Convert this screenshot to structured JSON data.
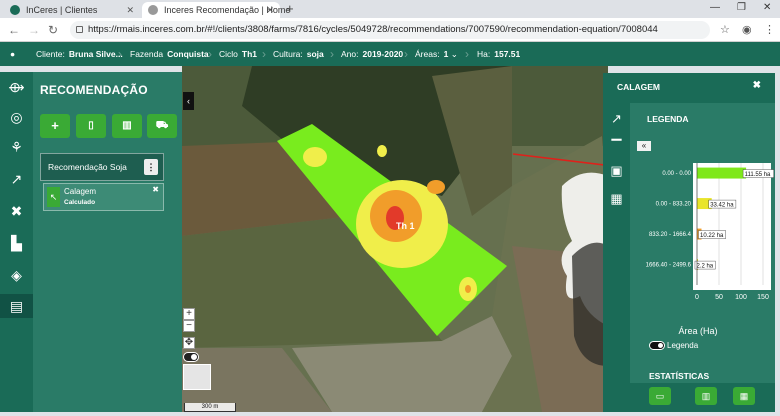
{
  "browser": {
    "tabs": [
      {
        "title": "InCeres | Clientes",
        "active": false
      },
      {
        "title": "Inceres Recomendação | Home",
        "active": true
      }
    ],
    "new_tab": "+",
    "url": "https://rmais.inceres.com.br/#!/clients/3808/farms/7816/cycles/5049728/recommendations/7007590/recommendation-equation/7008044"
  },
  "infobar": {
    "cliente_label": "Cliente:",
    "cliente": "Bruna Silve...",
    "fazenda_label": "Fazenda",
    "fazenda": "Conquista",
    "ciclo_label": "Ciclo",
    "ciclo": "Th1",
    "cultura_label": "Cultura:",
    "cultura": "soja",
    "ano_label": "Ano:",
    "ano": "2019-2020",
    "areas_label": "Áreas:",
    "areas": "1",
    "ha_label": "Ha:",
    "ha": "157.51"
  },
  "recommendation": {
    "title": "RECOMENDAÇÃO",
    "group_label": "Recomendação Soja",
    "group_menu": "⋮",
    "item": {
      "name": "Calagem",
      "status": "Calculado"
    }
  },
  "map": {
    "field_label": "Th 1",
    "scale_label": "300 m"
  },
  "calagem_panel": {
    "title": "CALAGEM",
    "legend_heading": "LEGENDA",
    "legend_toggle_label": "Legenda",
    "stats_heading": "ESTATÍSTICAS"
  },
  "chart_data": {
    "type": "bar",
    "orientation": "horizontal",
    "categories": [
      "0.00 - 0.00",
      "0.00 - 833.20",
      "833.20 - 1666.4",
      "1666.40 - 2499.6"
    ],
    "values": [
      111.55,
      33.42,
      10.22,
      2.2
    ],
    "data_labels": [
      "111.55 ha",
      "33.42 ha",
      "10.22 ha",
      "2.2 ha"
    ],
    "bar_colors": [
      "#7fe81a",
      "#e9e52a",
      "#f19d2a",
      "#e9e52a"
    ],
    "xlabel": "Área (Ha)",
    "xticks": [
      0,
      50,
      100,
      150
    ],
    "xlim": [
      0,
      150
    ],
    "grid": true
  }
}
